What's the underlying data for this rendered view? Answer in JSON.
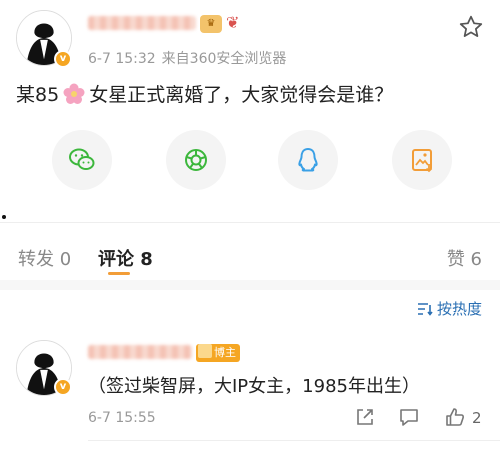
{
  "post": {
    "avatar_icon": "avatar-silhouette-icon",
    "verified_icon": "verified-v-icon",
    "verified_letter": "v",
    "badge_icon": "crown-badge-icon",
    "bow_icon": "bow-icon",
    "time": "6-7 15:32",
    "source": "来自360安全浏览器",
    "favorite_icon": "star-icon",
    "text_before": "某85",
    "flower_icon": "cherry-blossom-emoji",
    "text_after": "女星正式离婚了，大家觉得会是谁？"
  },
  "share": [
    {
      "name": "wechat",
      "icon": "wechat-icon",
      "color": "#3cb73c"
    },
    {
      "name": "moments",
      "icon": "moments-icon",
      "color": "#3cb73c"
    },
    {
      "name": "qq",
      "icon": "qq-icon",
      "color": "#3aa0e6"
    },
    {
      "name": "save-image",
      "icon": "save-image-icon",
      "color": "#f29d38"
    }
  ],
  "tabs": {
    "repost": "转发 0",
    "comments": "评论 8",
    "likes": "赞 6"
  },
  "sort": {
    "icon": "sort-icon",
    "label": "按热度"
  },
  "comment": {
    "author_tag": "博主",
    "text": "（签过柴智屏，大IP女主，1985年出生）",
    "time": "6-7 15:55",
    "like_count": "2"
  },
  "colors": {
    "accent": "#f29d38",
    "link": "#2a6fb3",
    "verified": "#f5a623"
  }
}
